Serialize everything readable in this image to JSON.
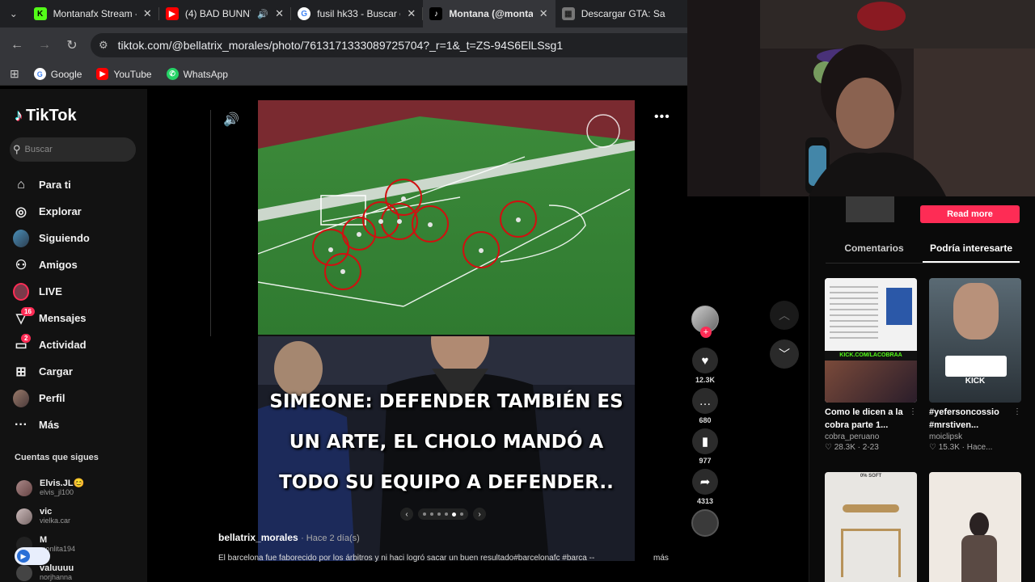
{
  "browser": {
    "tabs": [
      {
        "title": "Montanafx Stream -",
        "favicon": "kick-icon",
        "color": "#53fc18",
        "glyph": "K"
      },
      {
        "title": "(4) BAD BUNNY -",
        "favicon": "youtube-icon",
        "color": "#ff0000",
        "glyph": "▶"
      },
      {
        "title": "fusil hk33 - Buscar co",
        "favicon": "google-icon",
        "color": "#ffffff",
        "glyph": "G"
      },
      {
        "title": "Montana (@montan",
        "favicon": "tiktok-icon",
        "color": "#000000",
        "glyph": "♪"
      },
      {
        "title": "Descargar GTA: Sa",
        "favicon": "gta-icon",
        "color": "#8a8a8a",
        "glyph": "▦"
      }
    ],
    "url": "tiktok.com/@bellatrix_morales/photo/7613171333089725704?_r=1&_t=ZS-94S6ElLSsg1",
    "bookmarks": [
      {
        "label": "Google",
        "icon": "google-icon",
        "glyph": "G",
        "color": "#ffffff"
      },
      {
        "label": "YouTube",
        "icon": "youtube-icon",
        "glyph": "▶",
        "color": "#ff0000"
      },
      {
        "label": "WhatsApp",
        "icon": "whatsapp-icon",
        "glyph": "✆",
        "color": "#25d366"
      }
    ]
  },
  "sidebar": {
    "logo": "TikTok",
    "search_placeholder": "Buscar",
    "items": [
      {
        "label": "Para ti",
        "icon": "home-icon",
        "glyph": "⌂"
      },
      {
        "label": "Explorar",
        "icon": "compass-icon",
        "glyph": "◎"
      },
      {
        "label": "Siguiendo",
        "icon": "following-avatar-icon",
        "glyph": ""
      },
      {
        "label": "Amigos",
        "icon": "friends-icon",
        "glyph": "⚇"
      },
      {
        "label": "LIVE",
        "icon": "live-icon",
        "glyph": ""
      },
      {
        "label": "Mensajes",
        "icon": "messages-icon",
        "glyph": "▽",
        "badge": "16"
      },
      {
        "label": "Actividad",
        "icon": "activity-icon",
        "glyph": "▭",
        "badge": "2"
      },
      {
        "label": "Cargar",
        "icon": "upload-icon",
        "glyph": "⊞"
      },
      {
        "label": "Perfil",
        "icon": "profile-avatar-icon",
        "glyph": ""
      },
      {
        "label": "Más",
        "icon": "more-icon",
        "glyph": "···"
      }
    ],
    "following_title": "Cuentas que sigues",
    "following": [
      {
        "name": "Elvis.JL😊",
        "handle": "elvis_jl100"
      },
      {
        "name": "vic",
        "handle": "vielka.car"
      },
      {
        "name": "M",
        "handle": "monlita194"
      },
      {
        "name": "valuuuu",
        "handle": "norjhanna"
      }
    ]
  },
  "post": {
    "caption_lines": [
      "SIMEONE: DEFENDER TAMBIÉN ES",
      "UN ARTE, EL CHOLO MANDÓ A",
      "TODO SU EQUIPO A DEFENDER.."
    ],
    "author": "bellatrix_morales",
    "time_ago": "· Hace 2 día(s)",
    "description": "El barcelona fue faborecido por los árbitros y ni haci logró sacar un buen resultado#barcelonafc #barca --",
    "more": "más",
    "stats": {
      "likes": "12.3K",
      "comments": "680",
      "saves": "977",
      "shares": "4313"
    },
    "carousel": {
      "total": 5,
      "active": 4
    }
  },
  "right_panel": {
    "read_more": "Read more",
    "tabs": [
      "Comentarios",
      "Podría interesarte"
    ],
    "active_tab": 1,
    "cards": [
      {
        "title": "Como le dicen a la cobra parte 1...",
        "user": "cobra_peruano",
        "meta": "♡ 28.3K · 2-23",
        "thumb_text": "KICK.COM/LACOBRAA"
      },
      {
        "title": "#yefersoncossio #mrstiven...",
        "user": "moiclipsk",
        "meta": "♡ 15.3K · Hace...",
        "thumb_text": "KICK"
      },
      {
        "title": "",
        "user": "",
        "meta": "",
        "thumb_text": "0% SOFT"
      },
      {
        "title": "",
        "user": "",
        "meta": "",
        "thumb_text": ""
      }
    ]
  },
  "colors": {
    "accent": "#fe2c55",
    "bg": "#000000",
    "chrome": "#35363a"
  }
}
